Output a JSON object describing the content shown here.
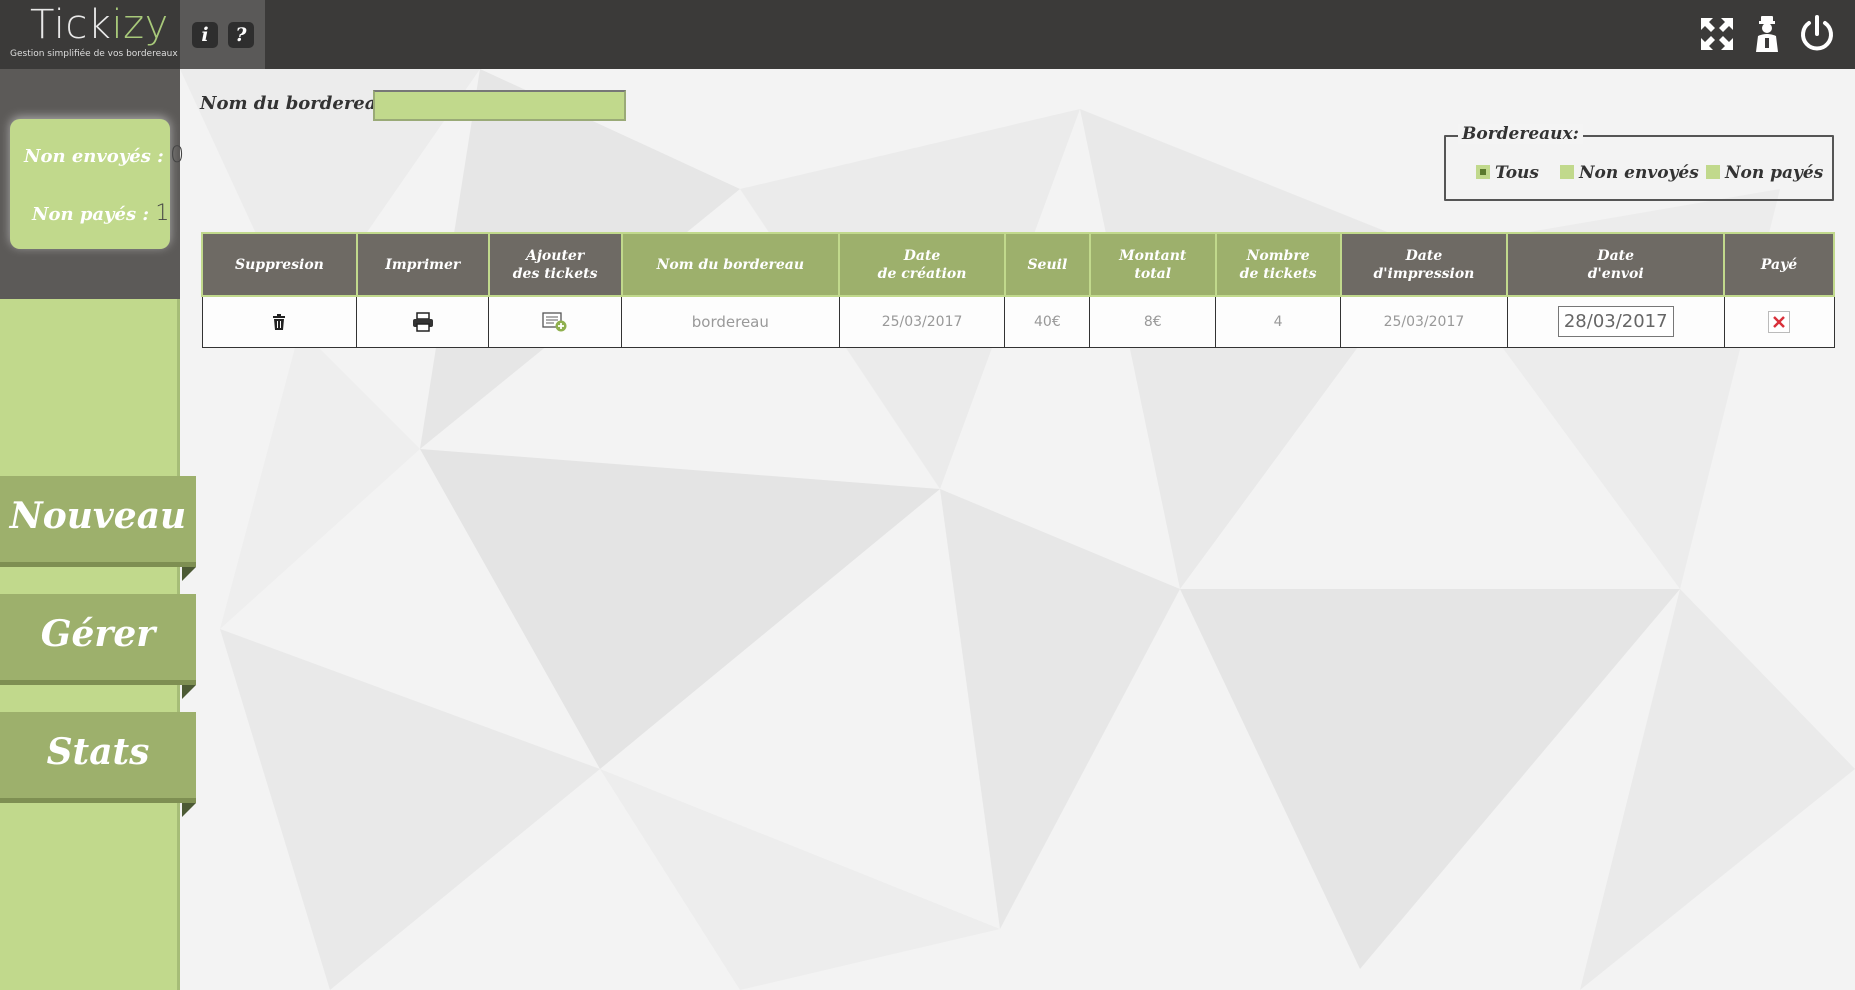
{
  "app": {
    "title_part1": "Tick",
    "title_part2": "izy",
    "subtitle": "Gestion simplifiée de vos bordereaux",
    "info_label": "i",
    "help_label": "?"
  },
  "sidebar": {
    "counters": {
      "non_envoyes_label": "Non envoyés :",
      "non_envoyes_value": "0",
      "non_payes_label": "Non payés :",
      "non_payes_value": "1"
    },
    "nav": [
      {
        "label": "Nouveau"
      },
      {
        "label": "Gérer"
      },
      {
        "label": "Stats"
      }
    ]
  },
  "search": {
    "label": "Nom du bordereau:",
    "value": ""
  },
  "filter": {
    "legend": "Bordereaux:",
    "options": [
      {
        "label": "Tous",
        "checked": true
      },
      {
        "label": "Non envoyés",
        "checked": false
      },
      {
        "label": "Non payés",
        "checked": false
      }
    ]
  },
  "table": {
    "headers": [
      {
        "line1": "Suppresion",
        "line2": ""
      },
      {
        "line1": "Imprimer",
        "line2": ""
      },
      {
        "line1": "Ajouter",
        "line2": "des tickets"
      },
      {
        "line1": "Nom du bordereau",
        "line2": ""
      },
      {
        "line1": "Date",
        "line2": "de création"
      },
      {
        "line1": "Seuil",
        "line2": ""
      },
      {
        "line1": "Montant",
        "line2": "total"
      },
      {
        "line1": "Nombre",
        "line2": "de tickets"
      },
      {
        "line1": "Date",
        "line2": "d'impression"
      },
      {
        "line1": "Date",
        "line2": "d'envoi"
      },
      {
        "line1": "Payé",
        "line2": ""
      }
    ],
    "rows": [
      {
        "name": "bordereau",
        "date_creation": "25/03/2017",
        "seuil": "40€",
        "montant_total": "8€",
        "nombre_tickets": "4",
        "date_impression": "25/03/2017",
        "date_envoi": "28/03/2017",
        "paye": false
      }
    ]
  },
  "colors": {
    "topbar": "#3b3a39",
    "green_light": "#c1d98c",
    "green_dark": "#9db06c",
    "header_dark": "#6e6a64",
    "paid_no": "#d9303a"
  }
}
